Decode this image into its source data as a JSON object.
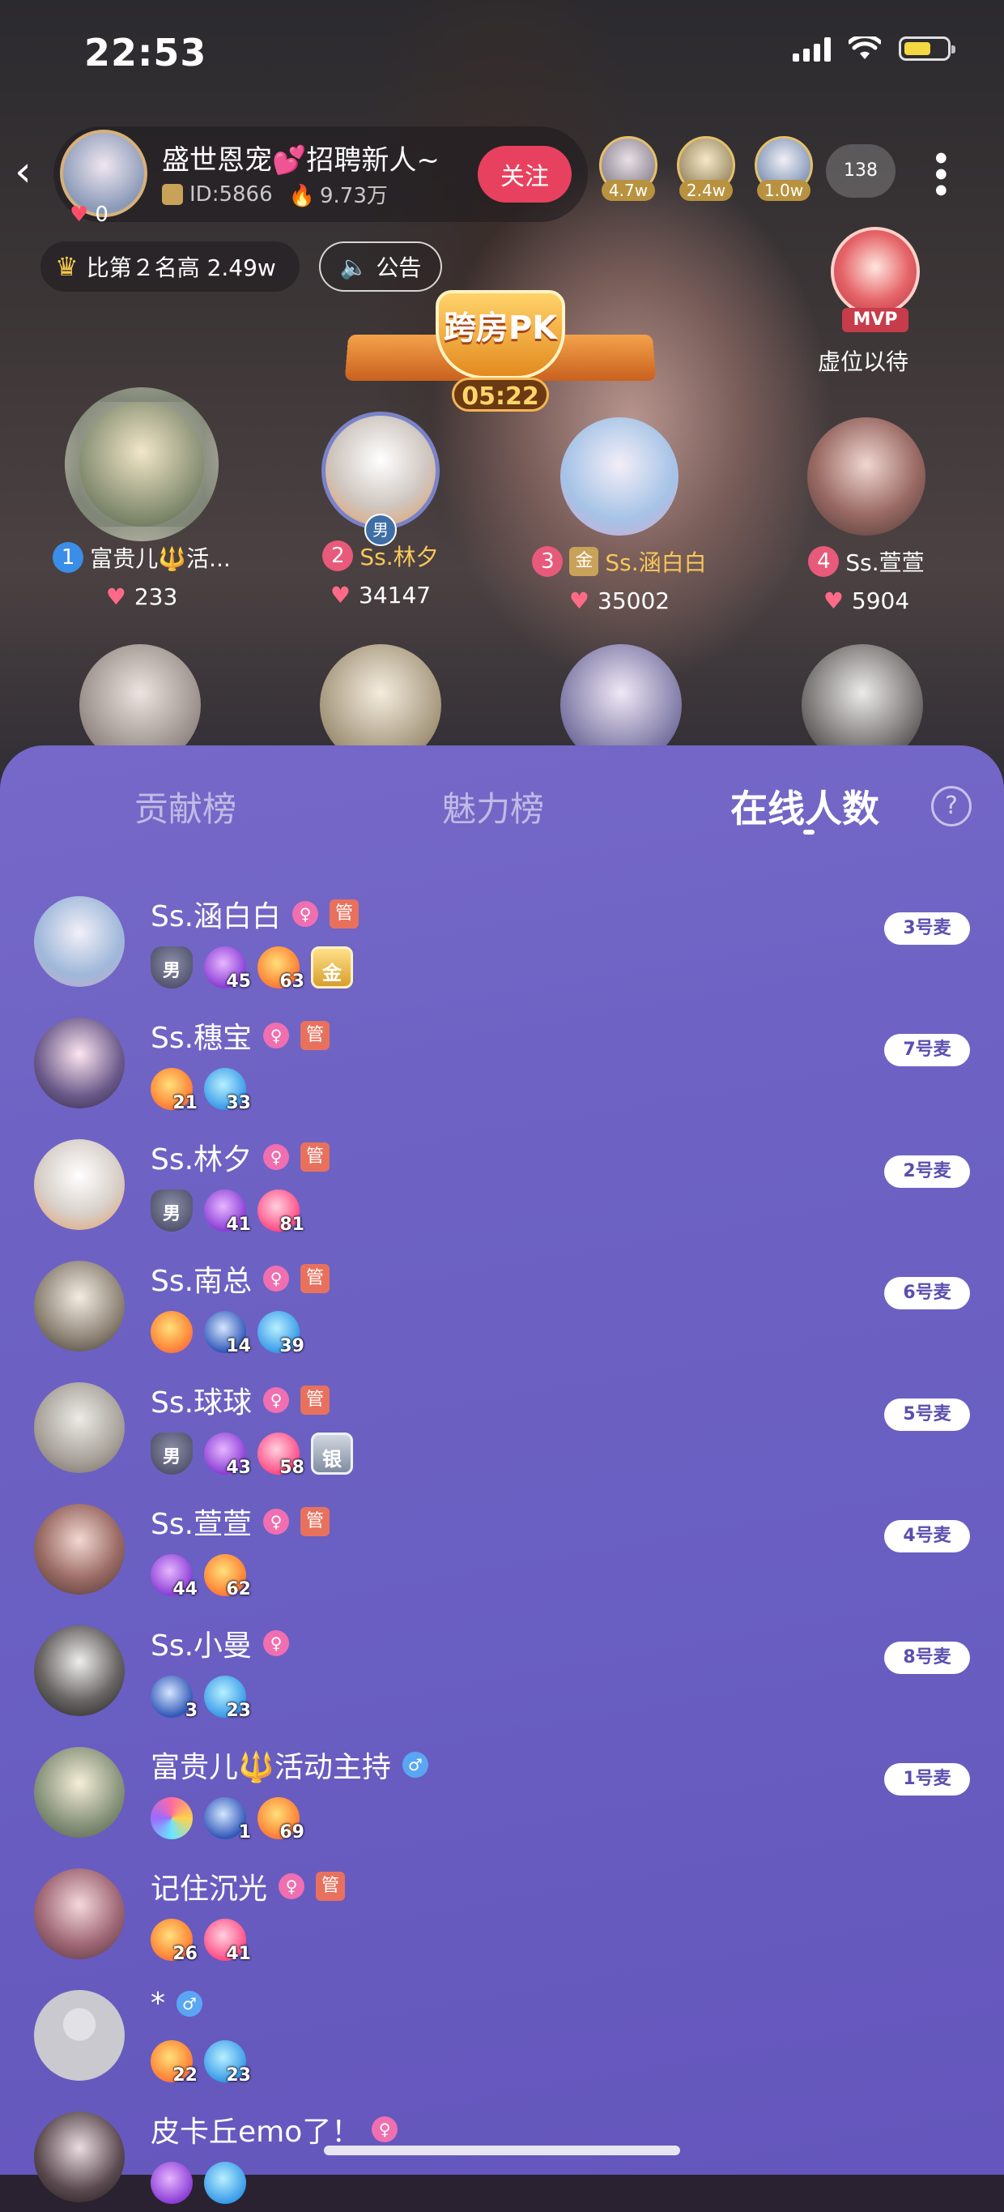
{
  "status": {
    "time": "22:53"
  },
  "room": {
    "name": "盛世恩宠💕招聘新人~",
    "id": "ID:5866",
    "heat": "9.73万",
    "likes": "0",
    "follow_label": "关注",
    "top_contributors": [
      "4.7w",
      "2.4w",
      "1.0w"
    ],
    "online_count": "138",
    "rank_text": "比第２名高 2.49w",
    "notice_label": "公告"
  },
  "pk": {
    "title": "跨房PK",
    "timer": "05:22"
  },
  "mvp": {
    "tag": "MVP",
    "label": "虚位以待"
  },
  "seats": [
    {
      "num": "1",
      "name": "富贵儿🔱活...",
      "hearts": "233"
    },
    {
      "num": "2",
      "name": "Ss.林夕",
      "hearts": "34147",
      "gender": "男"
    },
    {
      "num": "3",
      "name": "Ss.涵白白",
      "hearts": "35002",
      "badge": "金"
    },
    {
      "num": "4",
      "name": "Ss.萱萱",
      "hearts": "5904"
    }
  ],
  "tabs": {
    "contribution": "贡献榜",
    "charm": "魅力榜",
    "online": "在线人数",
    "help": "?"
  },
  "users": [
    {
      "name": "Ss.涵白白",
      "gender": "♀",
      "admin": "管",
      "badges": [
        {
          "t": "male",
          "txt": "男"
        },
        {
          "t": "purple",
          "lv": "45"
        },
        {
          "t": "orange",
          "lv": "63"
        },
        {
          "t": "gold-sq",
          "txt": "金"
        }
      ],
      "mic": "3号麦"
    },
    {
      "name": "Ss.穗宝",
      "gender": "♀",
      "admin": "管",
      "badges": [
        {
          "t": "orange",
          "lv": "21"
        },
        {
          "t": "blue",
          "lv": "33"
        }
      ],
      "mic": "7号麦"
    },
    {
      "name": "Ss.林夕",
      "gender": "♀",
      "admin": "管",
      "badges": [
        {
          "t": "male",
          "txt": "男"
        },
        {
          "t": "purple",
          "lv": "41"
        },
        {
          "t": "pink",
          "lv": "81"
        }
      ],
      "mic": "2号麦"
    },
    {
      "name": "Ss.南总",
      "gender": "♀",
      "admin": "管",
      "badges": [
        {
          "t": "orange",
          "lv": ""
        },
        {
          "t": "dblue",
          "lv": "14"
        },
        {
          "t": "blue",
          "lv": "39"
        }
      ],
      "mic": "6号麦"
    },
    {
      "name": "Ss.球球",
      "gender": "♀",
      "admin": "管",
      "badges": [
        {
          "t": "male",
          "txt": "男"
        },
        {
          "t": "purple",
          "lv": "43"
        },
        {
          "t": "pink",
          "lv": "58"
        },
        {
          "t": "silver-sq",
          "txt": "银"
        }
      ],
      "mic": "5号麦"
    },
    {
      "name": "Ss.萱萱",
      "gender": "♀",
      "admin": "管",
      "badges": [
        {
          "t": "purple",
          "lv": "44"
        },
        {
          "t": "orange",
          "lv": "62"
        }
      ],
      "mic": "4号麦"
    },
    {
      "name": "Ss.小曼",
      "gender": "♀",
      "admin": "",
      "badges": [
        {
          "t": "dblue",
          "lv": "3"
        },
        {
          "t": "blue",
          "lv": "23"
        }
      ],
      "mic": "8号麦"
    },
    {
      "name": "富贵儿🔱活动主持",
      "gender": "♂",
      "admin": "",
      "badges": [
        {
          "t": "rainbow",
          "lv": ""
        },
        {
          "t": "dblue",
          "lv": "1"
        },
        {
          "t": "orange",
          "lv": "69"
        }
      ],
      "mic": "1号麦"
    },
    {
      "name": "记住沉光",
      "gender": "♀",
      "admin": "管",
      "badges": [
        {
          "t": "orange",
          "lv": "26"
        },
        {
          "t": "pink",
          "lv": "41"
        }
      ],
      "mic": ""
    },
    {
      "name": "*",
      "gender": "♂",
      "admin": "",
      "badges": [
        {
          "t": "orange",
          "lv": "22"
        },
        {
          "t": "blue",
          "lv": "23"
        }
      ],
      "mic": ""
    },
    {
      "name": "皮卡丘emo了！",
      "gender": "♀",
      "admin": "",
      "badges": [
        {
          "t": "purple",
          "lv": ""
        },
        {
          "t": "blue",
          "lv": ""
        }
      ],
      "mic": ""
    }
  ],
  "colors": {
    "sheet": "#6a5fc2",
    "follow": "#e8415f",
    "female": "#ef6fb0",
    "male": "#5aa6f5",
    "admin": "#e8715e"
  }
}
